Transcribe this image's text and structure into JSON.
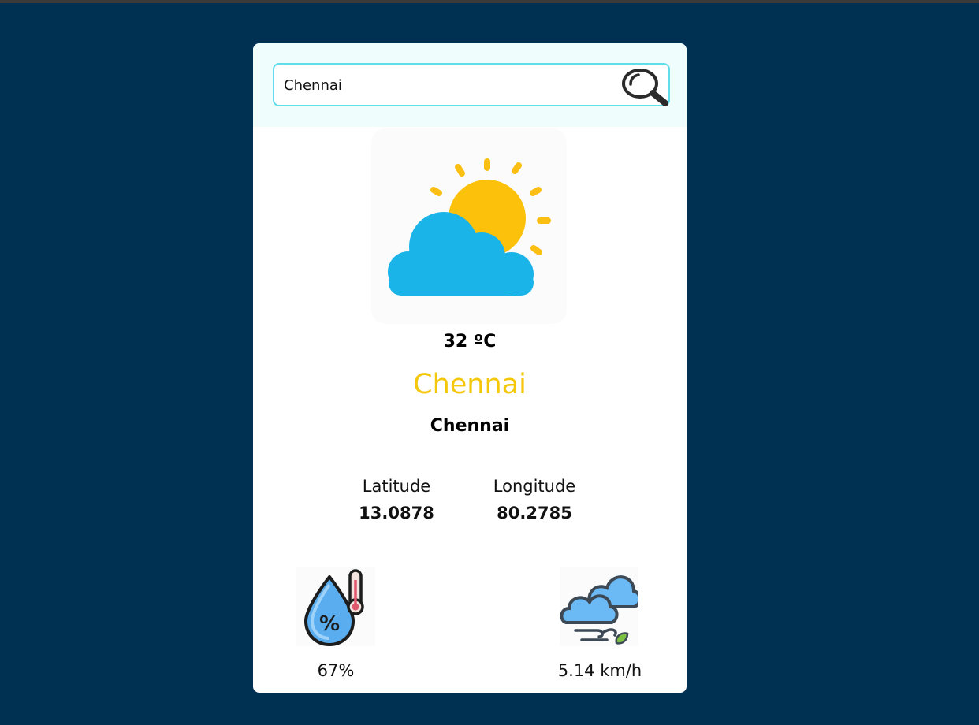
{
  "search": {
    "value": "Chennai",
    "icon": "search-icon"
  },
  "weather": {
    "icon": "partly-cloudy-icon",
    "temperature": "32 ºC",
    "city": "Chennai",
    "location": "Chennai"
  },
  "coordinates": {
    "latitude_label": "Latitude",
    "latitude_value": "13.0878",
    "longitude_label": "Longitude",
    "longitude_value": "80.2785"
  },
  "stats": {
    "humidity_icon": "humidity-icon",
    "humidity": "67%",
    "wind_icon": "wind-icon",
    "wind": "5.14 km/h"
  },
  "colors": {
    "background": "#003052",
    "accent_city": "#f4c70a",
    "search_border": "#5fdde9",
    "search_bg": "#effdfd"
  }
}
